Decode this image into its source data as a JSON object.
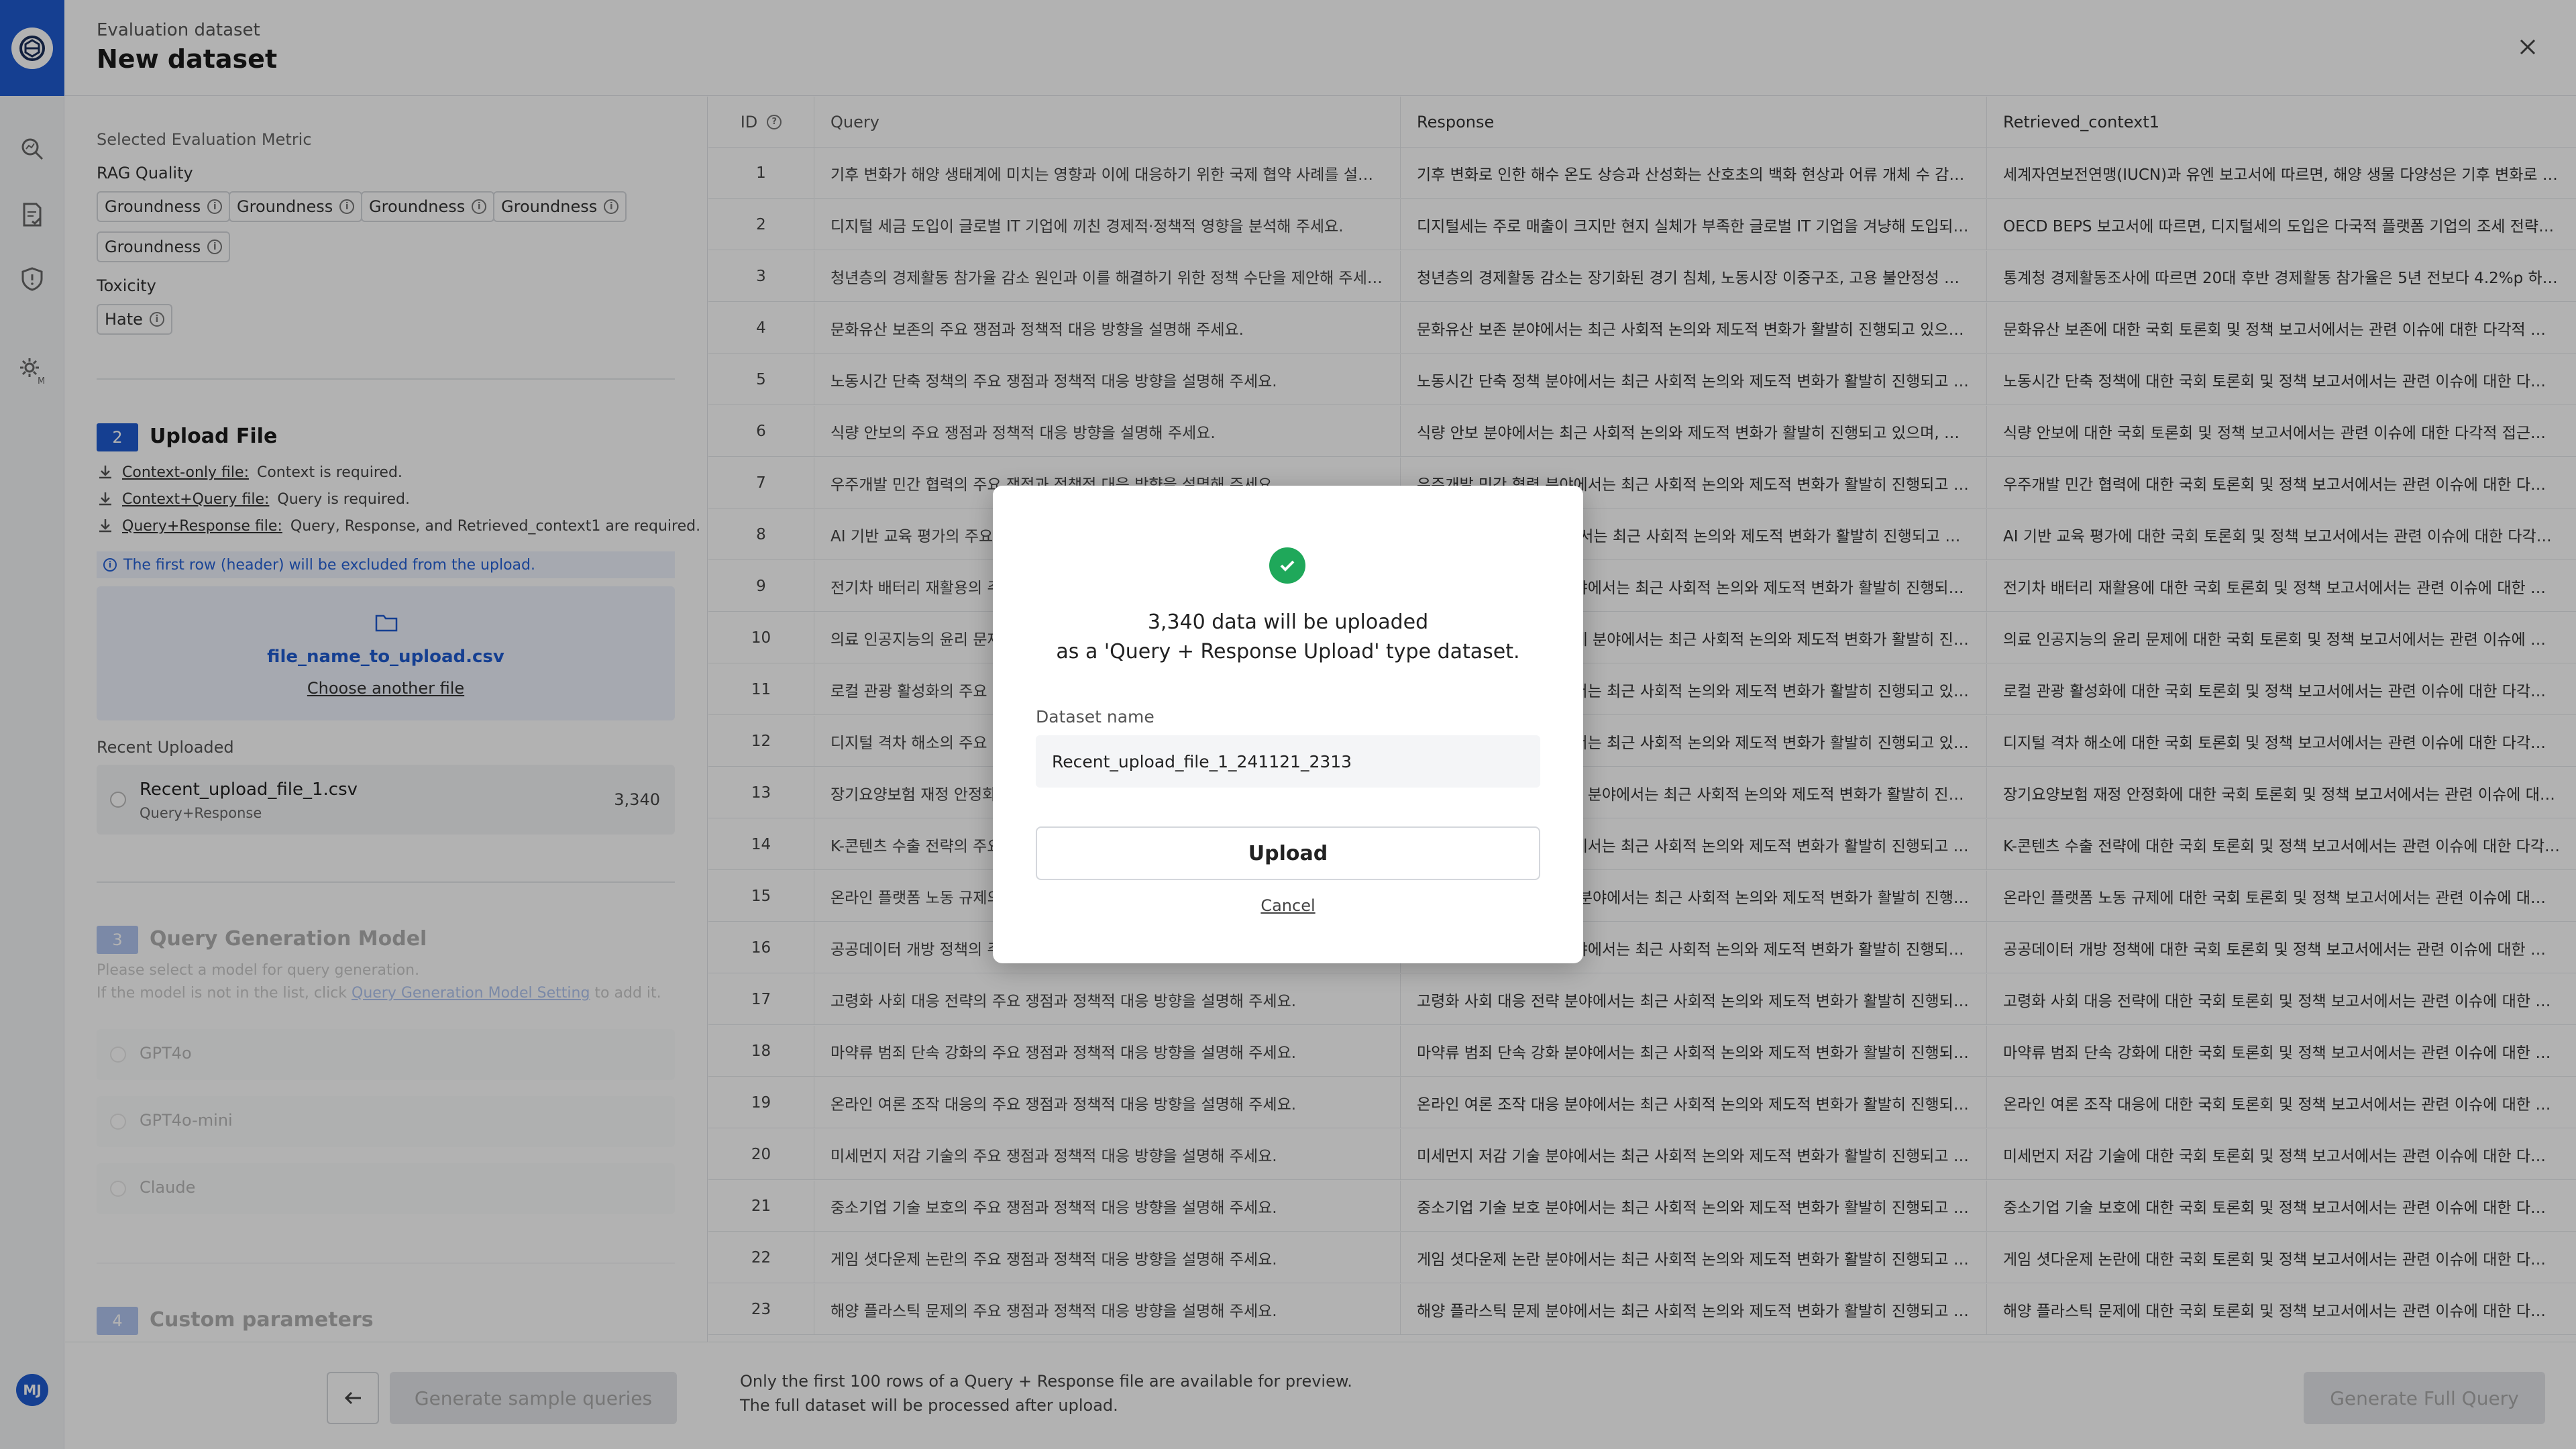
{
  "header": {
    "subtitle": "Evaluation dataset",
    "title": "New dataset"
  },
  "rail": {
    "avatar_initials": "MJ",
    "brand_color": "#1f5bd0"
  },
  "metrics": {
    "section_label": "Selected Evaluation Metric",
    "rag_quality_label": "RAG Quality",
    "rag_quality_chips": [
      "Groundness",
      "Groundness",
      "Groundness",
      "Groundness",
      "Groundness"
    ],
    "toxicity_label": "Toxicity",
    "toxicity_chips": [
      "Hate"
    ]
  },
  "upload": {
    "step": "2",
    "title": "Upload File",
    "files": [
      {
        "name": "Context-only file:",
        "desc": "Context is required."
      },
      {
        "name": "Context+Query file:",
        "desc": "Query is required."
      },
      {
        "name": "Query+Response file:",
        "desc": "Query, Response, and Retrieved_context1 are required."
      }
    ],
    "note": "The first row (header) will be excluded from the upload.",
    "file_name": "file_name_to_upload.csv",
    "choose_another": "Choose another file",
    "recent_label": "Recent Uploaded",
    "recent": {
      "name": "Recent_upload_file_1.csv",
      "type": "Query+Response",
      "count": "3,340"
    }
  },
  "query_gen": {
    "step": "3",
    "title": "Query Generation Model",
    "desc1": "Please select a model for query generation.",
    "desc2_prefix": "If the model is not in the list, click",
    "desc2_link": "Query Generation Model Setting",
    "desc2_suffix": "to add it.",
    "models": [
      "GPT4o",
      "GPT4o-mini",
      "Claude"
    ]
  },
  "custom": {
    "step": "4",
    "title": "Custom parameters"
  },
  "left_footer": {
    "generate_label": "Generate sample queries"
  },
  "table": {
    "headers": {
      "id": "ID",
      "query": "Query",
      "response": "Response",
      "context": "Retrieved_context1"
    },
    "rows": [
      {
        "id": "1",
        "q": "기후 변화가 해양 생태계에 미치는 영향과 이에 대응하기 위한 국제 협약 사례를 설명해 주세요.",
        "r": "기후 변화로 인한 해수 온도 상승과 산성화는 산호초의 백화 현상과 어류 개체 수 감소를 일으킵니다.",
        "c": "세계자연보전연맹(IUCN)과 유엔 보고서에 따르면, 해양 생물 다양성은 기후 변화로 위협받고 있습니다."
      },
      {
        "id": "2",
        "q": "디지털 세금 도입이 글로벌 IT 기업에 끼친 경제적·정책적 영향을 분석해 주세요.",
        "r": "디지털세는 주로 매출이 크지만 현지 실체가 부족한 글로벌 IT 기업을 겨냥해 도입되었습니다.",
        "c": "OECD BEPS 보고서에 따르면, 디지털세의 도입은 다국적 플랫폼 기업의 조세 전략에 영향을 줍니다."
      },
      {
        "id": "3",
        "q": "청년층의 경제활동 참가율 감소 원인과 이를 해결하기 위한 정책 수단을 제안해 주세요.",
        "r": "청년층의 경제활동 감소는 장기화된 경기 침체, 노동시장 이중구조, 고용 불안정성 때문입니다.",
        "c": "통계청 경제활동조사에 따르면 20대 후반 경제활동 참가율은 5년 전보다 4.2%p 하락했습니다."
      },
      {
        "id": "4",
        "q": "문화유산 보존의 주요 쟁점과 정책적 대응 방향을 설명해 주세요.",
        "r": "문화유산 보존 분야에서는 최근 사회적 논의와 제도적 변화가 활발히 진행되고 있으며, 다양한 이해관계가 얽혀 있습니다.",
        "c": "문화유산 보존에 대한 국회 토론회 및 정책 보고서에서는 관련 이슈에 대한 다각적 접근이 제시되었습니다."
      },
      {
        "id": "5",
        "q": "노동시간 단축 정책의 주요 쟁점과 정책적 대응 방향을 설명해 주세요.",
        "r": "노동시간 단축 정책 분야에서는 최근 사회적 논의와 제도적 변화가 활발히 진행되고 있습니다.",
        "c": "노동시간 단축 정책에 대한 국회 토론회 및 정책 보고서에서는 관련 이슈에 대한 다각적 접근이 제시되었습니다."
      },
      {
        "id": "6",
        "q": "식량 안보의 주요 쟁점과 정책적 대응 방향을 설명해 주세요.",
        "r": "식량 안보 분야에서는 최근 사회적 논의와 제도적 변화가 활발히 진행되고 있으며, 다양한 이해관계가 얽혀 있습니다.",
        "c": "식량 안보에 대한 국회 토론회 및 정책 보고서에서는 관련 이슈에 대한 다각적 접근이 제시되었습니다."
      },
      {
        "id": "7",
        "q": "우주개발 민간 협력의 주요 쟁점과 정책적 대응 방향을 설명해 주세요.",
        "r": "우주개발 민간 협력 분야에서는 최근 사회적 논의와 제도적 변화가 활발히 진행되고 있습니다.",
        "c": "우주개발 민간 협력에 대한 국회 토론회 및 정책 보고서에서는 관련 이슈에 대한 다각적 접근이 제시되었습니다."
      },
      {
        "id": "8",
        "q": "AI 기반 교육 평가의 주요 쟁점과 정책적 대응 방향을 설명해 주세요.",
        "r": "AI 기반 교육 평가 분야에서는 최근 사회적 논의와 제도적 변화가 활발히 진행되고 있습니다.",
        "c": "AI 기반 교육 평가에 대한 국회 토론회 및 정책 보고서에서는 관련 이슈에 대한 다각적 접근이 제시되었습니다."
      },
      {
        "id": "9",
        "q": "전기차 배터리 재활용의 주요 쟁점과 정책적 대응 방향을 설명해 주세요.",
        "r": "전기차 배터리 재활용 분야에서는 최근 사회적 논의와 제도적 변화가 활발히 진행되고 있습니다.",
        "c": "전기차 배터리 재활용에 대한 국회 토론회 및 정책 보고서에서는 관련 이슈에 대한 다각적 접근이 제시되었습니다."
      },
      {
        "id": "10",
        "q": "의료 인공지능의 윤리 문제의 주요 쟁점과 정책적 대응 방향을 설명해 주세요.",
        "r": "의료 인공지능의 윤리 문제 분야에서는 최근 사회적 논의와 제도적 변화가 활발히 진행되고 있습니다.",
        "c": "의료 인공지능의 윤리 문제에 대한 국회 토론회 및 정책 보고서에서는 관련 이슈에 대한 다각적 접근이 제시되었습니다."
      },
      {
        "id": "11",
        "q": "로컬 관광 활성화의 주요 쟁점과 정책적 대응 방향을 설명해 주세요.",
        "r": "로컬 관광 활성화 분야에서는 최근 사회적 논의와 제도적 변화가 활발히 진행되고 있습니다.",
        "c": "로컬 관광 활성화에 대한 국회 토론회 및 정책 보고서에서는 관련 이슈에 대한 다각적 접근이 제시되었습니다."
      },
      {
        "id": "12",
        "q": "디지털 격차 해소의 주요 쟁점과 정책적 대응 방향을 설명해 주세요.",
        "r": "디지털 격차 해소 분야에서는 최근 사회적 논의와 제도적 변화가 활발히 진행되고 있습니다.",
        "c": "디지털 격차 해소에 대한 국회 토론회 및 정책 보고서에서는 관련 이슈에 대한 다각적 접근이 제시되었습니다."
      },
      {
        "id": "13",
        "q": "장기요양보험 재정 안정화의 주요 쟁점과 정책적 대응 방향을 설명해 주세요.",
        "r": "장기요양보험 재정 안정화 분야에서는 최근 사회적 논의와 제도적 변화가 활발히 진행되고 있습니다.",
        "c": "장기요양보험 재정 안정화에 대한 국회 토론회 및 정책 보고서에서는 관련 이슈에 대한 다각적 접근이 제시되었습니다."
      },
      {
        "id": "14",
        "q": "K-콘텐츠 수출 전략의 주요 쟁점과 정책적 대응 방향을 설명해 주세요.",
        "r": "K-콘텐츠 수출 전략 분야에서는 최근 사회적 논의와 제도적 변화가 활발히 진행되고 있습니다.",
        "c": "K-콘텐츠 수출 전략에 대한 국회 토론회 및 정책 보고서에서는 관련 이슈에 대한 다각적 접근이 제시되었습니다."
      },
      {
        "id": "15",
        "q": "온라인 플랫폼 노동 규제의 주요 쟁점과 정책적 대응 방향을 설명해 주세요.",
        "r": "온라인 플랫폼 노동 규제 분야에서는 최근 사회적 논의와 제도적 변화가 활발히 진행되고 있습니다.",
        "c": "온라인 플랫폼 노동 규제에 대한 국회 토론회 및 정책 보고서에서는 관련 이슈에 대한 다각적 접근이 제시되었습니다."
      },
      {
        "id": "16",
        "q": "공공데이터 개방 정책의 주요 쟁점과 정책적 대응 방향을 설명해 주세요.",
        "r": "공공데이터 개방 정책 분야에서는 최근 사회적 논의와 제도적 변화가 활발히 진행되고 있습니다.",
        "c": "공공데이터 개방 정책에 대한 국회 토론회 및 정책 보고서에서는 관련 이슈에 대한 다각적 접근이 제시되었습니다."
      },
      {
        "id": "17",
        "q": "고령화 사회 대응 전략의 주요 쟁점과 정책적 대응 방향을 설명해 주세요.",
        "r": "고령화 사회 대응 전략 분야에서는 최근 사회적 논의와 제도적 변화가 활발히 진행되고 있습니다.",
        "c": "고령화 사회 대응 전략에 대한 국회 토론회 및 정책 보고서에서는 관련 이슈에 대한 다각적 접근이 제시되었습니다."
      },
      {
        "id": "18",
        "q": "마약류 범죄 단속 강화의 주요 쟁점과 정책적 대응 방향을 설명해 주세요.",
        "r": "마약류 범죄 단속 강화 분야에서는 최근 사회적 논의와 제도적 변화가 활발히 진행되고 있습니다.",
        "c": "마약류 범죄 단속 강화에 대한 국회 토론회 및 정책 보고서에서는 관련 이슈에 대한 다각적 접근이 제시되었습니다."
      },
      {
        "id": "19",
        "q": "온라인 여론 조작 대응의 주요 쟁점과 정책적 대응 방향을 설명해 주세요.",
        "r": "온라인 여론 조작 대응 분야에서는 최근 사회적 논의와 제도적 변화가 활발히 진행되고 있습니다.",
        "c": "온라인 여론 조작 대응에 대한 국회 토론회 및 정책 보고서에서는 관련 이슈에 대한 다각적 접근이 제시되었습니다."
      },
      {
        "id": "20",
        "q": "미세먼지 저감 기술의 주요 쟁점과 정책적 대응 방향을 설명해 주세요.",
        "r": "미세먼지 저감 기술 분야에서는 최근 사회적 논의와 제도적 변화가 활발히 진행되고 있습니다.",
        "c": "미세먼지 저감 기술에 대한 국회 토론회 및 정책 보고서에서는 관련 이슈에 대한 다각적 접근이 제시되었습니다."
      },
      {
        "id": "21",
        "q": "중소기업 기술 보호의 주요 쟁점과 정책적 대응 방향을 설명해 주세요.",
        "r": "중소기업 기술 보호 분야에서는 최근 사회적 논의와 제도적 변화가 활발히 진행되고 있습니다.",
        "c": "중소기업 기술 보호에 대한 국회 토론회 및 정책 보고서에서는 관련 이슈에 대한 다각적 접근이 제시되었습니다."
      },
      {
        "id": "22",
        "q": "게임 셧다운제 논란의 주요 쟁점과 정책적 대응 방향을 설명해 주세요.",
        "r": "게임 셧다운제 논란 분야에서는 최근 사회적 논의와 제도적 변화가 활발히 진행되고 있습니다.",
        "c": "게임 셧다운제 논란에 대한 국회 토론회 및 정책 보고서에서는 관련 이슈에 대한 다각적 접근이 제시되었습니다."
      },
      {
        "id": "23",
        "q": "해양 플라스틱 문제의 주요 쟁점과 정책적 대응 방향을 설명해 주세요.",
        "r": "해양 플라스틱 문제 분야에서는 최근 사회적 논의와 제도적 변화가 활발히 진행되고 있습니다.",
        "c": "해양 플라스틱 문제에 대한 국회 토론회 및 정책 보고서에서는 관련 이슈에 대한 다각적 접근이 제시되었습니다."
      }
    ]
  },
  "right_footer": {
    "note1": "Only the first 100 rows of a Query + Response file are available for preview.",
    "note2": "The full dataset will be processed after upload.",
    "generate_full_label": "Generate Full Query"
  },
  "modal": {
    "line1": "3,340 data will be uploaded",
    "line2": "as a 'Query + Response Upload' type dataset.",
    "dataset_name_label": "Dataset name",
    "dataset_name_value": "Recent_upload_file_1_241121_2313",
    "upload_label": "Upload",
    "cancel_label": "Cancel",
    "success_color": "#1fa85a"
  }
}
